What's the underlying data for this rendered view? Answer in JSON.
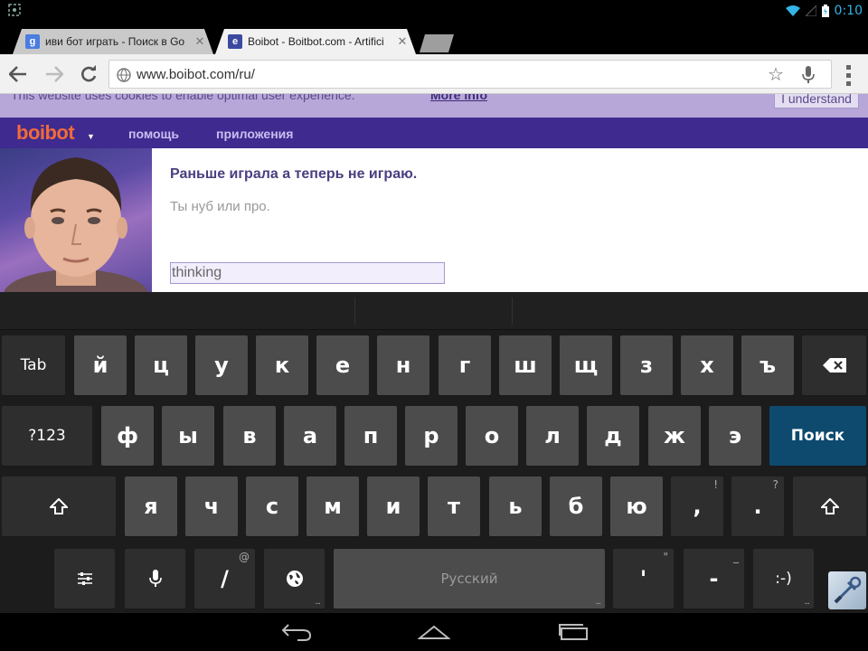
{
  "status_bar": {
    "time": "0:10",
    "left_icon": "screenshot-icon",
    "icons": [
      "wifi-icon",
      "signal-icon",
      "battery-icon"
    ]
  },
  "tabs": [
    {
      "favicon": "google-favicon",
      "favicon_text": "g",
      "title": "иви бот играть - Поиск в Go"
    },
    {
      "favicon": "boibot-favicon",
      "favicon_text": "e",
      "title": "Boibot - Boitbot.com - Artifici"
    }
  ],
  "tab_close_glyph": "✕",
  "toolbar": {
    "url": "www.boibot.com/ru/",
    "icons": [
      "back-icon",
      "forward-icon",
      "reload-icon",
      "globe-icon",
      "star-icon",
      "mic-icon",
      "overflow-menu-icon"
    ]
  },
  "page": {
    "cookie_banner": {
      "text": "This website uses cookies to enable optimal user experience.",
      "more_info": "More info",
      "button": "I understand"
    },
    "nav": {
      "logo": "boibot",
      "help": "помощь",
      "apps": "приложения"
    },
    "bot_message": "Раньше играла а теперь не играю.",
    "user_message": "Ты нуб или про.",
    "input_value": "thinking"
  },
  "keyboard": {
    "row1": [
      "Tab",
      "й",
      "ц",
      "у",
      "к",
      "е",
      "н",
      "г",
      "ш",
      "щ",
      "з",
      "х",
      "ъ"
    ],
    "row2": [
      "?123",
      "ф",
      "ы",
      "в",
      "а",
      "п",
      "р",
      "о",
      "л",
      "д",
      "ж",
      "э",
      "Поиск"
    ],
    "row3": [
      "я",
      "ч",
      "с",
      "м",
      "и",
      "т",
      "ь",
      "б",
      "ю",
      ",",
      "."
    ],
    "row3_hints": {
      "comma": "!",
      "period": "?"
    },
    "row4": {
      "settings_icon": "settings-sliders-icon",
      "mic_icon": "mic-icon",
      "slash": "/",
      "slash_hint": "@",
      "globe_icon": "language-globe-icon",
      "space": "Русский",
      "apostrophe": "'",
      "apostrophe_hint": "\"",
      "dash": "-",
      "dash_hint": "_",
      "smiley": ":-)"
    },
    "dots": "..."
  },
  "system_nav": {
    "icons": [
      "nav-back-icon",
      "nav-home-icon",
      "nav-recent-apps-icon"
    ]
  },
  "colors": {
    "accent": "#33b5e5",
    "nav_purple": "#3f2a8f",
    "cookie_purple": "#b7a6d8",
    "logo_orange": "#f26a3a",
    "search_key": "#0e4a6e"
  }
}
